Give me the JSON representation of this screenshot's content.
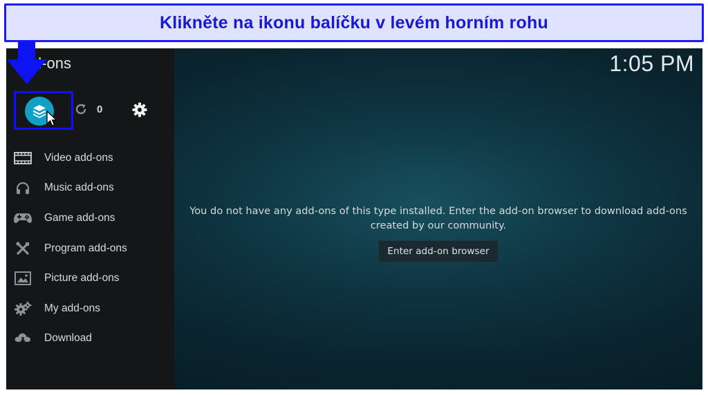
{
  "banner": {
    "text": "Klikněte na ikonu balíčku v levém horním rohu"
  },
  "app": {
    "section_title": "Add-ons",
    "clock": "1:05 PM"
  },
  "toolbar": {
    "update_count": "0"
  },
  "sidebar": {
    "items": [
      {
        "label": "Video add-ons",
        "icon": "film-icon"
      },
      {
        "label": "Music add-ons",
        "icon": "headphones-icon"
      },
      {
        "label": "Game add-ons",
        "icon": "gamepad-icon"
      },
      {
        "label": "Program add-ons",
        "icon": "tools-icon"
      },
      {
        "label": "Picture add-ons",
        "icon": "picture-icon"
      },
      {
        "label": "My add-ons",
        "icon": "gears-icon"
      },
      {
        "label": "Download",
        "icon": "cloud-download-icon"
      }
    ]
  },
  "main": {
    "message": "You do not have any add-ons of this type installed. Enter the add-on browser to download add-ons created by our community.",
    "enter_button": "Enter add-on browser"
  },
  "colors": {
    "banner_bg": "#dfe3ff",
    "banner_border": "#1a1aff",
    "banner_text": "#1a1acc",
    "accent": "#12a0c6",
    "sidebar_bg": "#141617"
  }
}
